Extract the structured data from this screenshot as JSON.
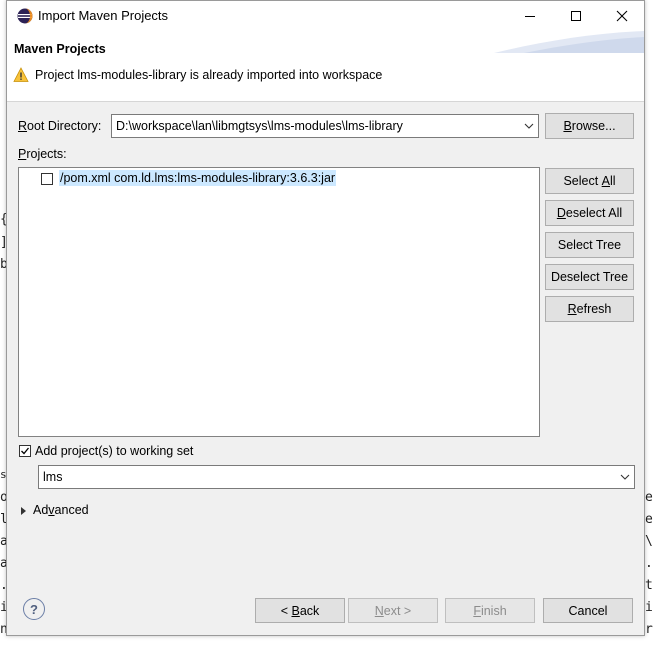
{
  "window": {
    "title": "Import Maven Projects"
  },
  "banner": {
    "title": "Maven Projects",
    "warning": "Project lms-modules-library is already imported into workspace"
  },
  "root_directory": {
    "label_prefix": "R",
    "label_rest": "oot Directory:",
    "value": "D:\\workspace\\lan\\libmgtsys\\lms-modules\\lms-library",
    "browse_prefix": "B",
    "browse_rest": "rowse..."
  },
  "projects": {
    "label_prefix": "P",
    "label_rest": "rojects:",
    "items": [
      {
        "text": "/pom.xml  com.ld.lms:lms-modules-library:3.6.3:jar",
        "checked": false
      }
    ]
  },
  "side_buttons": {
    "select_all": {
      "pre": "Select ",
      "u": "A",
      "post": "ll"
    },
    "deselect_all": {
      "pre": "",
      "u": "D",
      "post": "eselect All"
    },
    "select_tree": "Select Tree",
    "deselect_tree": "Deselect Tree",
    "refresh": {
      "pre": "",
      "u": "R",
      "post": "efresh"
    }
  },
  "working_set": {
    "label": "Add project(s) to working set",
    "checked": true,
    "value": "lms"
  },
  "advanced": {
    "pre": "Ad",
    "u": "v",
    "post": "anced"
  },
  "footer": {
    "back": {
      "pre": "< ",
      "u": "B",
      "post": "ack"
    },
    "next": {
      "pre": "",
      "u": "N",
      "post": "ext >"
    },
    "finish": {
      "pre": "",
      "u": "F",
      "post": "inish"
    },
    "cancel": "Cancel"
  },
  "background_fragments": [
    "{",
    "]",
    "b",
    "s)",
    "o",
    "l",
    "a",
    "a",
    ".",
    "i",
    "n",
    "e",
    "e",
    "\\",
    ".",
    "t",
    "i",
    "r"
  ]
}
